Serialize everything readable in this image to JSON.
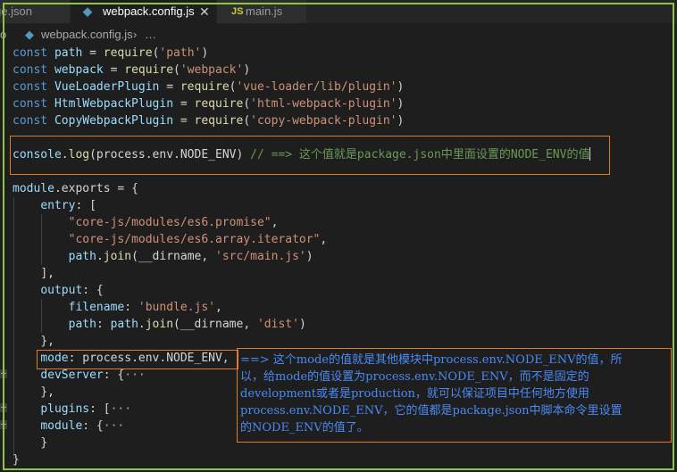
{
  "tabs": [
    {
      "label": "ge.json"
    },
    {
      "label": "webpack.config.js",
      "close": "✕"
    },
    {
      "label": "main.js",
      "icon_text": "JS"
    }
  ],
  "breadcrumb": {
    "root": "o",
    "file": "webpack.config.js",
    "separator": "›",
    "more": "…"
  },
  "code": {
    "l1": {
      "a": "const",
      "b": " path ",
      "c": "= ",
      "d": "require",
      "e": "(",
      "f": "'path'",
      "g": ")"
    },
    "l2": {
      "a": "const",
      "b": " webpack ",
      "c": "= ",
      "d": "require",
      "e": "(",
      "f": "'webpack'",
      "g": ")"
    },
    "l3": {
      "a": "const",
      "b": " VueLoaderPlugin ",
      "c": "= ",
      "d": "require",
      "e": "(",
      "f": "'vue-loader/lib/plugin'",
      "g": ")"
    },
    "l4": {
      "a": "const",
      "b": " HtmlWebpackPlugin ",
      "c": "= ",
      "d": "require",
      "e": "(",
      "f": "'html-webpack-plugin'",
      "g": ")"
    },
    "l5": {
      "a": "const",
      "b": " CopyWebpackPlugin ",
      "c": "= ",
      "d": "require",
      "e": "(",
      "f": "'copy-webpack-plugin'",
      "g": ")"
    },
    "console": {
      "obj": "console",
      "dot": ".",
      "fn": "log",
      "args": "(process.env.NODE_ENV)",
      "comment": " // ==> 这个值就是package.json中里面设置的NODE_ENV的值"
    },
    "exports": {
      "a": "module",
      "b": ".exports ",
      "c": "= {"
    },
    "entry": {
      "a": "entry",
      "b": ": ["
    },
    "e1": "\"core-js/modules/es6.promise\"",
    "e1c": ",",
    "e2": "\"core-js/modules/es6.array.iterator\"",
    "e2c": ",",
    "e3": {
      "a": "path",
      "b": ".",
      "c": "join",
      "d": "(__dirname, ",
      "e": "'src/main.js'",
      "f": ")"
    },
    "entryClose": "],",
    "output": {
      "a": "output",
      "b": ": {"
    },
    "filename": {
      "a": "filename",
      "b": ": ",
      "c": "'bundle.js'",
      "d": ","
    },
    "path": {
      "a": "path",
      "b": ": ",
      "c": "path",
      "d": ".",
      "e": "join",
      "f": "(__dirname, ",
      "g": "'dist'",
      "h": ")"
    },
    "outputClose": "},",
    "mode": {
      "a": "mode",
      "b": ": process.env.NODE_ENV,"
    },
    "devServer": {
      "a": "devServer",
      "b": ": {",
      "c": "···"
    },
    "devClose": "},",
    "plugins": {
      "a": "plugins",
      "b": ": [",
      "c": "···"
    },
    "module": {
      "a": "module",
      "b": ": {",
      "c": "···"
    },
    "moduleClose": "}",
    "end": "}"
  },
  "note": [
    "==> 这个mode的值就是其他模块中process.env.NODE_ENV的值，所",
    "以，给mode的值设置为process.env.NODE_ENV，而不是固定的",
    "development或者是production，就可以保证项目中任何地方使用",
    "process.env.NODE_ENV，它的值都是package.json中脚本命令里设置",
    "的NODE_ENV的值了。"
  ]
}
